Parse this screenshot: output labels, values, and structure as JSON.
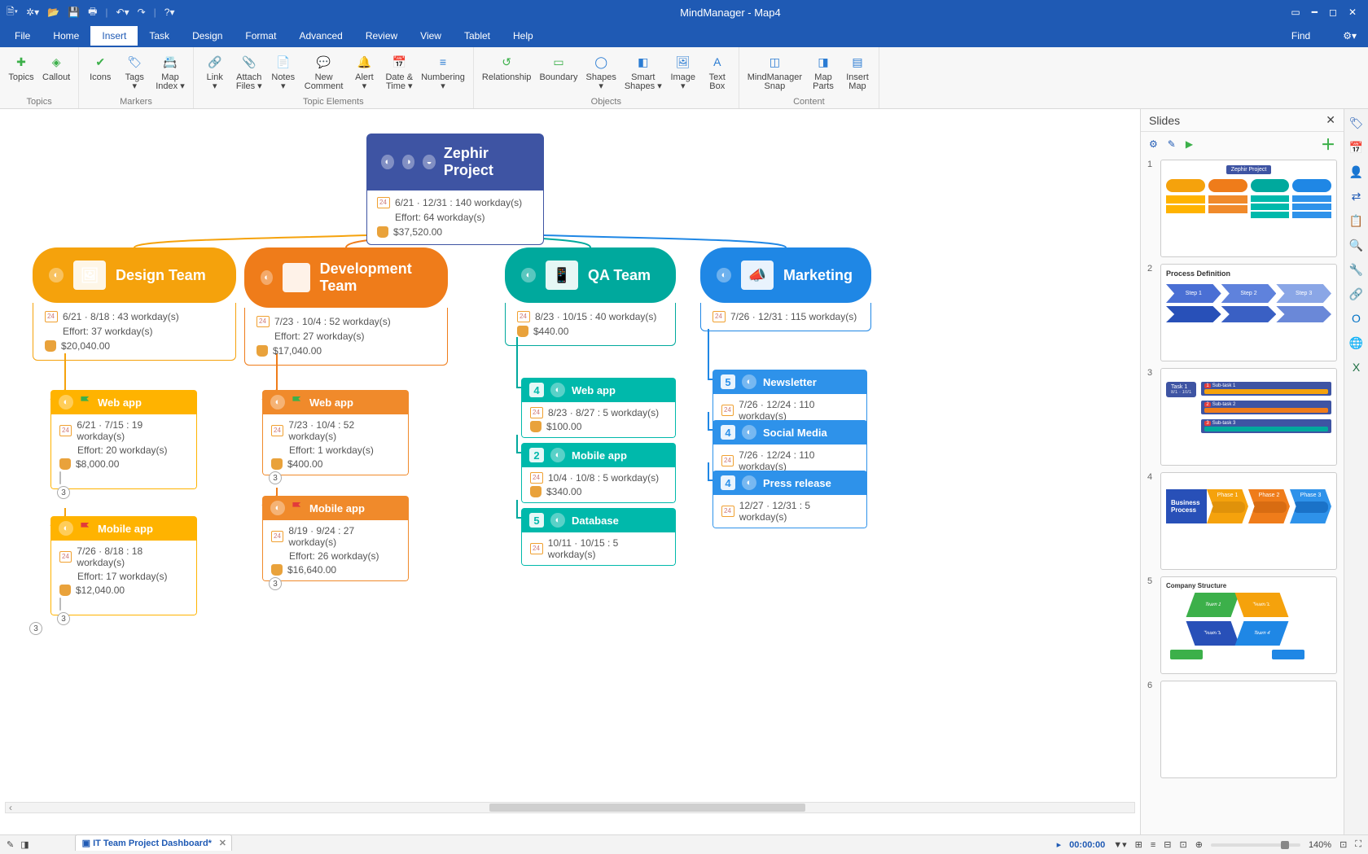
{
  "app": {
    "title": "MindManager - Map4",
    "find": "Find"
  },
  "menu": [
    "File",
    "Home",
    "Insert",
    "Task",
    "Design",
    "Format",
    "Advanced",
    "Review",
    "View",
    "Tablet",
    "Help"
  ],
  "menu_active": 2,
  "ribbon_groups": [
    {
      "label": "Topics",
      "items": [
        {
          "label": "Topics",
          "icon": "✚",
          "color": "#3cb04a"
        },
        {
          "label": "Callout",
          "icon": "◈",
          "color": "#3cb04a"
        }
      ]
    },
    {
      "label": "Markers",
      "items": [
        {
          "label": "Icons",
          "icon": "✔",
          "color": "#3cb04a"
        },
        {
          "label": "Tags\n▾",
          "icon": "🏷",
          "color": "#2b7cd3"
        },
        {
          "label": "Map\nIndex ▾",
          "icon": "📇",
          "color": "#2b7cd3"
        }
      ]
    },
    {
      "label": "Topic Elements",
      "items": [
        {
          "label": "Link\n▾",
          "icon": "🔗",
          "color": "#777"
        },
        {
          "label": "Attach\nFiles ▾",
          "icon": "📎",
          "color": "#777"
        },
        {
          "label": "Notes\n▾",
          "icon": "📄",
          "color": "#777"
        },
        {
          "label": "New\nComment",
          "icon": "💬",
          "color": "#2b7cd3"
        },
        {
          "label": "Alert\n▾",
          "icon": "🔔",
          "color": "#e9a23b"
        },
        {
          "label": "Date &\nTime ▾",
          "icon": "📅",
          "color": "#e9a23b"
        },
        {
          "label": "Numbering\n▾",
          "icon": "≡",
          "color": "#2b7cd3"
        }
      ]
    },
    {
      "label": "Objects",
      "items": [
        {
          "label": "Relationship",
          "icon": "↺",
          "color": "#3cb04a"
        },
        {
          "label": "Boundary",
          "icon": "▭",
          "color": "#3cb04a"
        },
        {
          "label": "Shapes\n▾",
          "icon": "◯",
          "color": "#2b7cd3"
        },
        {
          "label": "Smart\nShapes ▾",
          "icon": "◧",
          "color": "#2b7cd3"
        },
        {
          "label": "Image\n▾",
          "icon": "🖼",
          "color": "#2b7cd3"
        },
        {
          "label": "Text\nBox",
          "icon": "A",
          "color": "#2b7cd3"
        }
      ]
    },
    {
      "label": "Content",
      "items": [
        {
          "label": "MindManager\nSnap",
          "icon": "◫",
          "color": "#2b7cd3"
        },
        {
          "label": "Map\nParts",
          "icon": "◨",
          "color": "#2b7cd3"
        },
        {
          "label": "Insert\nMap",
          "icon": "▤",
          "color": "#2b7cd3"
        }
      ]
    }
  ],
  "root": {
    "title": "Zephir Project",
    "date": "6/21 · 12/31 : 140 workday(s)",
    "effort": "Effort: 64 workday(s)",
    "cost": "$37,520.00"
  },
  "teams": [
    {
      "name": "Design Team",
      "color": "#f5a20c",
      "accent": "#ffb300",
      "img": "🖼",
      "date": "6/21 · 8/18 : 43 workday(s)",
      "effort": "Effort: 37 workday(s)",
      "cost": "$20,040.00"
    },
    {
      "name": "Development Team",
      "color": "#ef7c1a",
      "accent": "#f08a2b",
      "img": "</>",
      "date": "7/23 · 10/4 : 52 workday(s)",
      "effort": "Effort: 27 workday(s)",
      "cost": "$17,040.00"
    },
    {
      "name": "QA Team",
      "color": "#00a99d",
      "accent": "#00b9ab",
      "img": "📱",
      "date": "8/23 · 10/15 : 40 workday(s)",
      "effort": "",
      "cost": "$440.00"
    },
    {
      "name": "Marketing",
      "color": "#1f87e5",
      "accent": "#2e92ea",
      "img": "📣",
      "date": "7/26 · 12/31 : 115 workday(s)",
      "effort": "",
      "cost": ""
    }
  ],
  "tasks_design": [
    {
      "name": "Web app",
      "color": "#ffb300",
      "date": "6/21 · 7/15 : 19 workday(s)",
      "effort": "Effort: 20 workday(s)",
      "cost": "$8,000.00",
      "note": true,
      "count": "3",
      "flag": "#3cb04a"
    },
    {
      "name": "Mobile app",
      "color": "#ffb300",
      "date": "7/26 · 8/18 : 18 workday(s)",
      "effort": "Effort: 17 workday(s)",
      "cost": "$12,040.00",
      "note": true,
      "count": "3",
      "flag": "#e23b3b"
    }
  ],
  "tasks_dev": [
    {
      "name": "Web app",
      "color": "#f08a2b",
      "date": "7/23 · 10/4 : 52 workday(s)",
      "effort": "Effort: 1 workday(s)",
      "cost": "$400.00",
      "count": "3",
      "flag": "#3cb04a"
    },
    {
      "name": "Mobile app",
      "color": "#f08a2b",
      "date": "8/19 · 9/24 : 27 workday(s)",
      "effort": "Effort: 26 workday(s)",
      "cost": "$16,640.00",
      "count": "3",
      "flag": "#e23b3b"
    }
  ],
  "tasks_qa": [
    {
      "name": "Web app",
      "color": "#00b9ab",
      "num": "4",
      "date": "8/23 · 8/27 : 5 workday(s)",
      "cost": "$100.00"
    },
    {
      "name": "Mobile app",
      "color": "#00b9ab",
      "num": "2",
      "date": "10/4 · 10/8 : 5 workday(s)",
      "cost": "$340.00"
    },
    {
      "name": "Database",
      "color": "#00b9ab",
      "num": "5",
      "date": "10/11 · 10/15 : 5 workday(s)"
    }
  ],
  "tasks_mkt": [
    {
      "name": "Newsletter",
      "color": "#2e92ea",
      "num": "5",
      "date": "7/26 · 12/24 : 110 workday(s)"
    },
    {
      "name": "Social Media",
      "color": "#2e92ea",
      "num": "4",
      "date": "7/26 · 12/24 : 110 workday(s)"
    },
    {
      "name": "Press release",
      "color": "#2e92ea",
      "num": "4",
      "date": "12/27 · 12/31 : 5 workday(s)"
    }
  ],
  "slides_panel": {
    "title": "Slides"
  },
  "slides": [
    {
      "num": "1",
      "title": "Zephir Project"
    },
    {
      "num": "2",
      "title": "Process Definition",
      "steps": [
        "Step 1",
        "Step 2",
        "Step 3"
      ]
    },
    {
      "num": "3",
      "title": "Task 1",
      "sub": [
        "Sub-task 1",
        "Sub-task 2",
        "Sub-task 3"
      ]
    },
    {
      "num": "4",
      "title": "Business Process",
      "phases": [
        "Phase 1",
        "Phase 2",
        "Phase 3"
      ]
    },
    {
      "num": "5",
      "title": "Company Structure",
      "teams": [
        "Team 1",
        "Team 2",
        "Team 3",
        "Team 4"
      ]
    },
    {
      "num": "6",
      "title": ""
    }
  ],
  "status": {
    "tab": "IT Team Project Dashboard*",
    "timer": "00:00:00",
    "zoom": "140%"
  }
}
